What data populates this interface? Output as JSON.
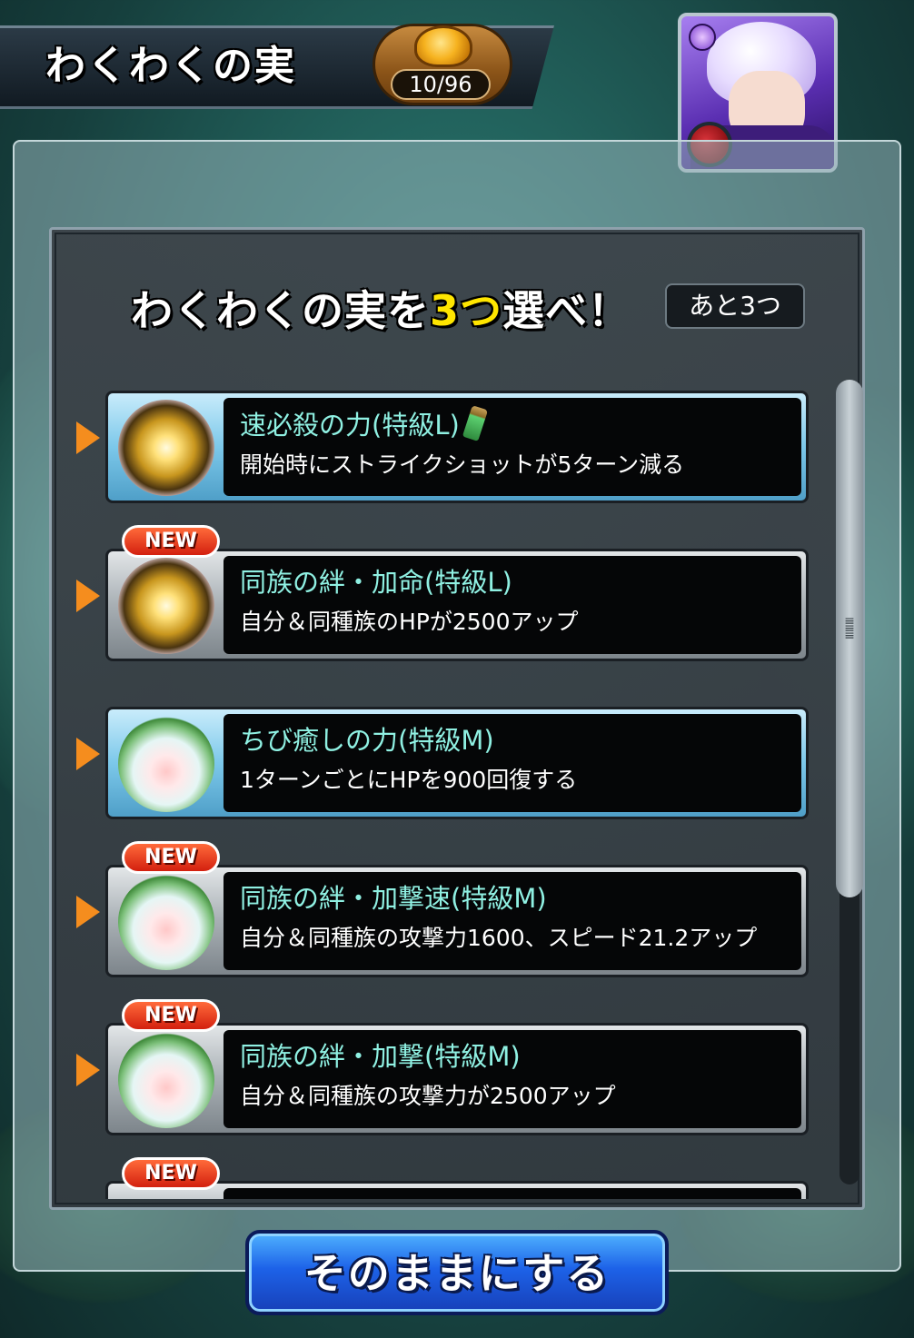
{
  "header": {
    "title": "わくわくの実",
    "count": "10/96",
    "count_icon": "golden-fruit-icon"
  },
  "avatar": {
    "character_icon": "character-portrait",
    "element_icon": "dark-element-icon",
    "fruit_badge_icon": "red-fruit-badge-icon"
  },
  "prompt": {
    "prefix": "わくわくの実を",
    "highlight": "3つ",
    "suffix": "選べ！",
    "remaining": "あと3つ"
  },
  "fruits": [
    {
      "title": "速必殺の力(特級L)",
      "desc": "開始時にストライクショットが5ターン減る",
      "new": "",
      "style": "blue",
      "icon": "gold-fruit-icon",
      "extra_icon": "potion-icon"
    },
    {
      "title": "同族の絆・加命(特級L)",
      "desc": "自分＆同種族のHPが2500アップ",
      "new": "NEW",
      "style": "gray",
      "icon": "gold-fruit-icon"
    },
    {
      "title": "ちび癒しの力(特級M)",
      "desc": "1ターンごとにHPを900回復する",
      "new": "",
      "style": "blue",
      "icon": "green-fruit-icon"
    },
    {
      "title": "同族の絆・加撃速(特級M)",
      "desc": "自分＆同種族の攻撃力1600、スピード21.2アップ",
      "new": "NEW",
      "style": "gray",
      "icon": "green-fruit-icon"
    },
    {
      "title": "同族の絆・加撃(特級M)",
      "desc": "自分＆同種族の攻撃力が2500アップ",
      "new": "NEW",
      "style": "gray",
      "icon": "green-fruit-icon"
    },
    {
      "title": "",
      "desc": "",
      "new": "NEW",
      "style": "gray",
      "icon": ""
    }
  ],
  "bottom_button": {
    "label": "そのままにする"
  },
  "colors": {
    "accent_highlight": "#ffe600",
    "title_text": "#8ff0e2",
    "arrow": "#f58d1e",
    "new_badge": "#d3200f",
    "button_blue": "#1d62e8"
  }
}
